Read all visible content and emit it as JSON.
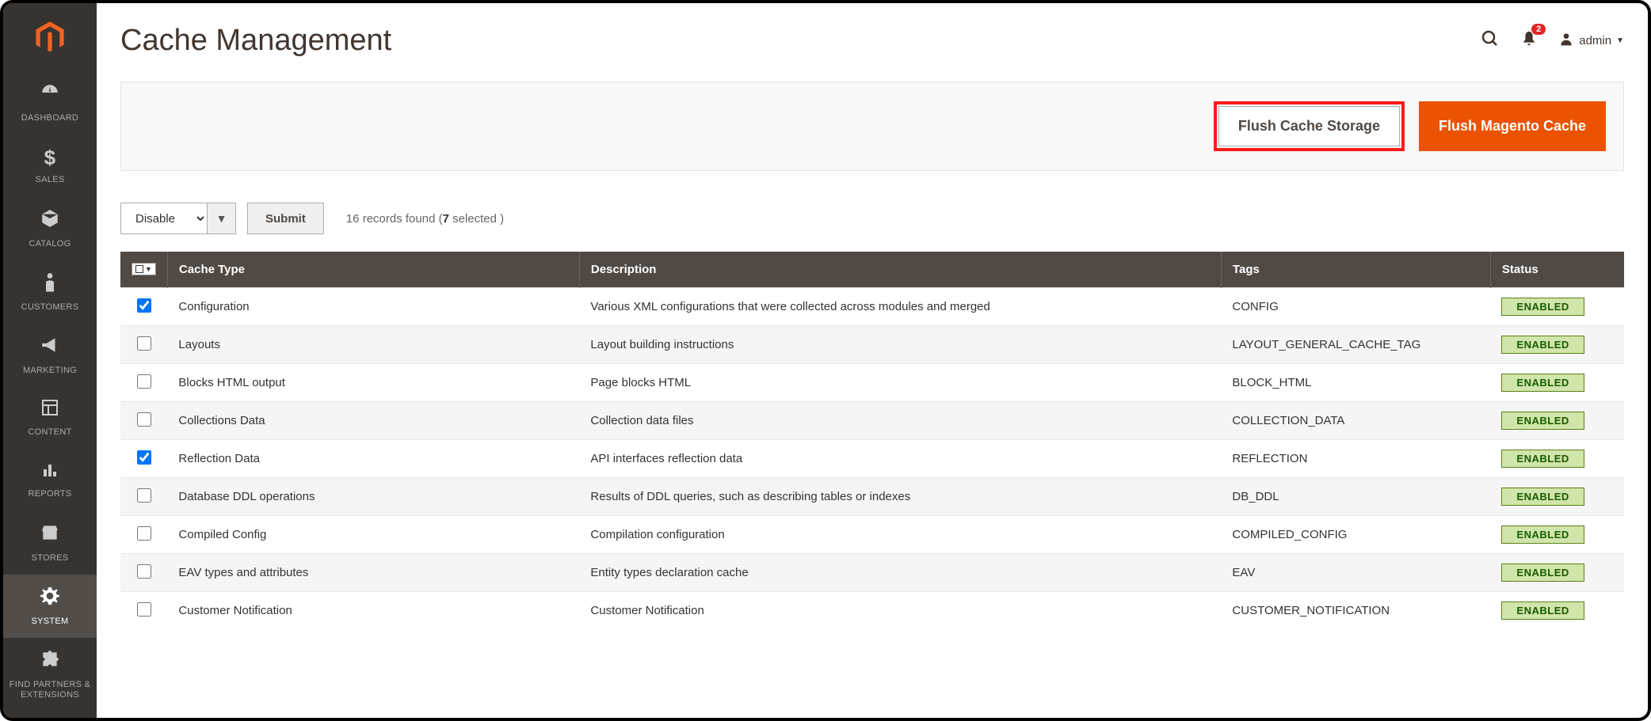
{
  "sidebar": {
    "items": [
      {
        "label": "DASHBOARD",
        "icon": "dashboard"
      },
      {
        "label": "SALES",
        "icon": "dollar"
      },
      {
        "label": "CATALOG",
        "icon": "box"
      },
      {
        "label": "CUSTOMERS",
        "icon": "person"
      },
      {
        "label": "MARKETING",
        "icon": "megaphone"
      },
      {
        "label": "CONTENT",
        "icon": "layout"
      },
      {
        "label": "REPORTS",
        "icon": "bars"
      },
      {
        "label": "STORES",
        "icon": "storefront"
      },
      {
        "label": "SYSTEM",
        "icon": "gear"
      },
      {
        "label": "FIND PARTNERS & EXTENSIONS",
        "icon": "puzzle"
      }
    ]
  },
  "header": {
    "title": "Cache Management",
    "notification_count": "2",
    "user_label": "admin"
  },
  "actions": {
    "flush_storage": "Flush Cache Storage",
    "flush_magento": "Flush Magento Cache"
  },
  "toolbar": {
    "mass_action_selected": "Disable",
    "submit_label": "Submit",
    "records_prefix": "16 records found (",
    "records_selected": "7",
    "records_suffix": " selected )"
  },
  "table": {
    "columns": {
      "cache_type": "Cache Type",
      "description": "Description",
      "tags": "Tags",
      "status": "Status"
    },
    "rows": [
      {
        "checked": true,
        "type": "Configuration",
        "desc": "Various XML configurations that were collected across modules and merged",
        "tags": "CONFIG",
        "status": "ENABLED"
      },
      {
        "checked": false,
        "type": "Layouts",
        "desc": "Layout building instructions",
        "tags": "LAYOUT_GENERAL_CACHE_TAG",
        "status": "ENABLED"
      },
      {
        "checked": false,
        "type": "Blocks HTML output",
        "desc": "Page blocks HTML",
        "tags": "BLOCK_HTML",
        "status": "ENABLED"
      },
      {
        "checked": false,
        "type": "Collections Data",
        "desc": "Collection data files",
        "tags": "COLLECTION_DATA",
        "status": "ENABLED"
      },
      {
        "checked": true,
        "type": "Reflection Data",
        "desc": "API interfaces reflection data",
        "tags": "REFLECTION",
        "status": "ENABLED"
      },
      {
        "checked": false,
        "type": "Database DDL operations",
        "desc": "Results of DDL queries, such as describing tables or indexes",
        "tags": "DB_DDL",
        "status": "ENABLED"
      },
      {
        "checked": false,
        "type": "Compiled Config",
        "desc": "Compilation configuration",
        "tags": "COMPILED_CONFIG",
        "status": "ENABLED"
      },
      {
        "checked": false,
        "type": "EAV types and attributes",
        "desc": "Entity types declaration cache",
        "tags": "EAV",
        "status": "ENABLED"
      },
      {
        "checked": false,
        "type": "Customer Notification",
        "desc": "Customer Notification",
        "tags": "CUSTOMER_NOTIFICATION",
        "status": "ENABLED"
      }
    ]
  }
}
